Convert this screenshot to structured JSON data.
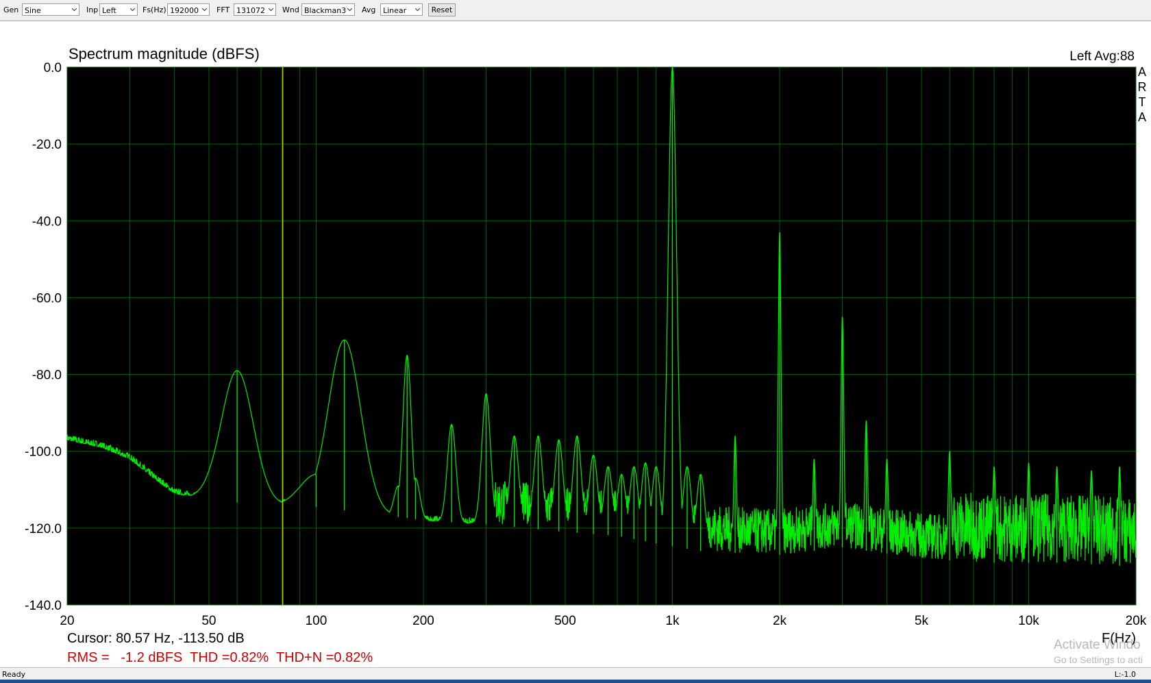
{
  "toolbar": {
    "gen_label": "Gen",
    "gen_value": "Sine",
    "inp_label": "Inp",
    "inp_value": "Left",
    "fs_label": "Fs(Hz)",
    "fs_value": "192000",
    "fft_label": "FFT",
    "fft_value": "131072",
    "wnd_label": "Wnd",
    "wnd_value": "Blackman3",
    "avg_label": "Avg",
    "avg_value": "Linear",
    "reset_label": "Reset"
  },
  "plot": {
    "title": "Spectrum magnitude (dBFS)",
    "channel_avg": "Left  Avg:88",
    "side_logo": [
      "A",
      "R",
      "T",
      "A"
    ],
    "cursor_text": "Cursor: 80.57 Hz, -113.50 dB",
    "measurements": "RMS =   -1.2 dBFS  THD =0.82%  THD+N =0.82%",
    "measurement_color": "#cc0000",
    "trace_color": "#00ee00",
    "grid_color": "#006000",
    "cursor_color": "#c8c800",
    "background_color": "#000000"
  },
  "chart_data": {
    "type": "line",
    "title": "Spectrum magnitude (dBFS)",
    "xlabel": "F(Hz)",
    "ylabel": "",
    "x_scale": "log",
    "xlim": [
      20,
      20000
    ],
    "ylim": [
      -140,
      0
    ],
    "grid": true,
    "y_ticks": [
      "0.0",
      "-20.0",
      "-40.0",
      "-60.0",
      "-80.0",
      "-100.0",
      "-120.0",
      "-140.0"
    ],
    "y_tick_values": [
      0,
      -20,
      -40,
      -60,
      -80,
      -100,
      -120,
      -140
    ],
    "x_ticks": [
      "20",
      "50",
      "100",
      "200",
      "500",
      "1k",
      "2k",
      "5k",
      "10k",
      "20k"
    ],
    "x_tick_values": [
      20,
      50,
      100,
      200,
      500,
      1000,
      2000,
      5000,
      10000,
      20000
    ],
    "cursor": {
      "x": 80.57,
      "y": -113.5
    },
    "noise_floor": {
      "x": [
        20,
        25,
        30,
        35,
        40,
        45,
        50,
        55,
        70,
        90,
        110,
        140,
        200,
        300,
        500,
        700,
        900,
        1200,
        2000,
        3000,
        5000,
        8000,
        12000,
        20000
      ],
      "y": [
        -97,
        -99,
        -102,
        -107,
        -111,
        -112,
        -112,
        -113,
        -114,
        -114,
        -115,
        -116,
        -118,
        -119,
        -121,
        -122,
        -124,
        -126,
        -127,
        -125,
        -128,
        -129,
        -129,
        -130
      ]
    },
    "series": [
      {
        "name": "",
        "x": [
          60,
          100,
          120,
          170,
          180,
          190,
          240,
          300,
          360,
          420,
          480,
          540,
          600,
          660,
          720,
          780,
          840,
          900,
          1000,
          1100,
          1200,
          1500,
          2000,
          2500,
          3000,
          3500,
          4000,
          6000,
          8000,
          10000,
          12000,
          15000,
          18000
        ],
        "y": [
          -79,
          -106,
          -71,
          -109,
          -75,
          -107,
          -93,
          -85,
          -96,
          -96,
          -97,
          -96,
          -101,
          -104,
          -106,
          -104,
          -103,
          -104,
          0,
          -104,
          -106,
          -96,
          -43,
          -102,
          -65,
          -92,
          -102,
          -100,
          -104,
          -103,
          -104,
          -105,
          -104
        ]
      }
    ]
  },
  "status": {
    "left": "Ready",
    "right": "L:-1.0"
  },
  "watermark": {
    "line1": "Activate Windo",
    "line2": "Go to Settings to acti"
  }
}
